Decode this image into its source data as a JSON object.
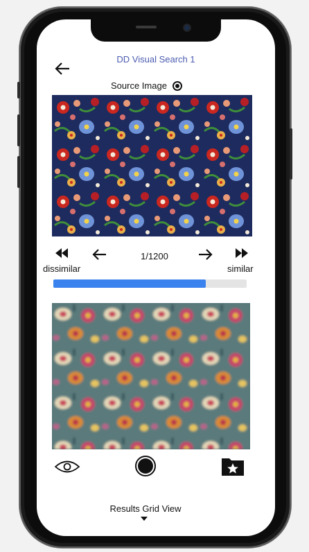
{
  "app": {
    "title": "DD Visual Search 1"
  },
  "source": {
    "label": "Source Image"
  },
  "navigation": {
    "counter": "1/1200",
    "dissimilar_label": "dissimilar",
    "similar_label": "similar",
    "progress_fraction": 0.79
  },
  "bottom_bar": {
    "icons": [
      "eye-icon",
      "record-icon",
      "folder-star-icon"
    ]
  },
  "results": {
    "label": "Results Grid View"
  },
  "colors": {
    "title": "#4a5bb0",
    "progress": "#3a82ee",
    "track": "#e4e4e4"
  }
}
